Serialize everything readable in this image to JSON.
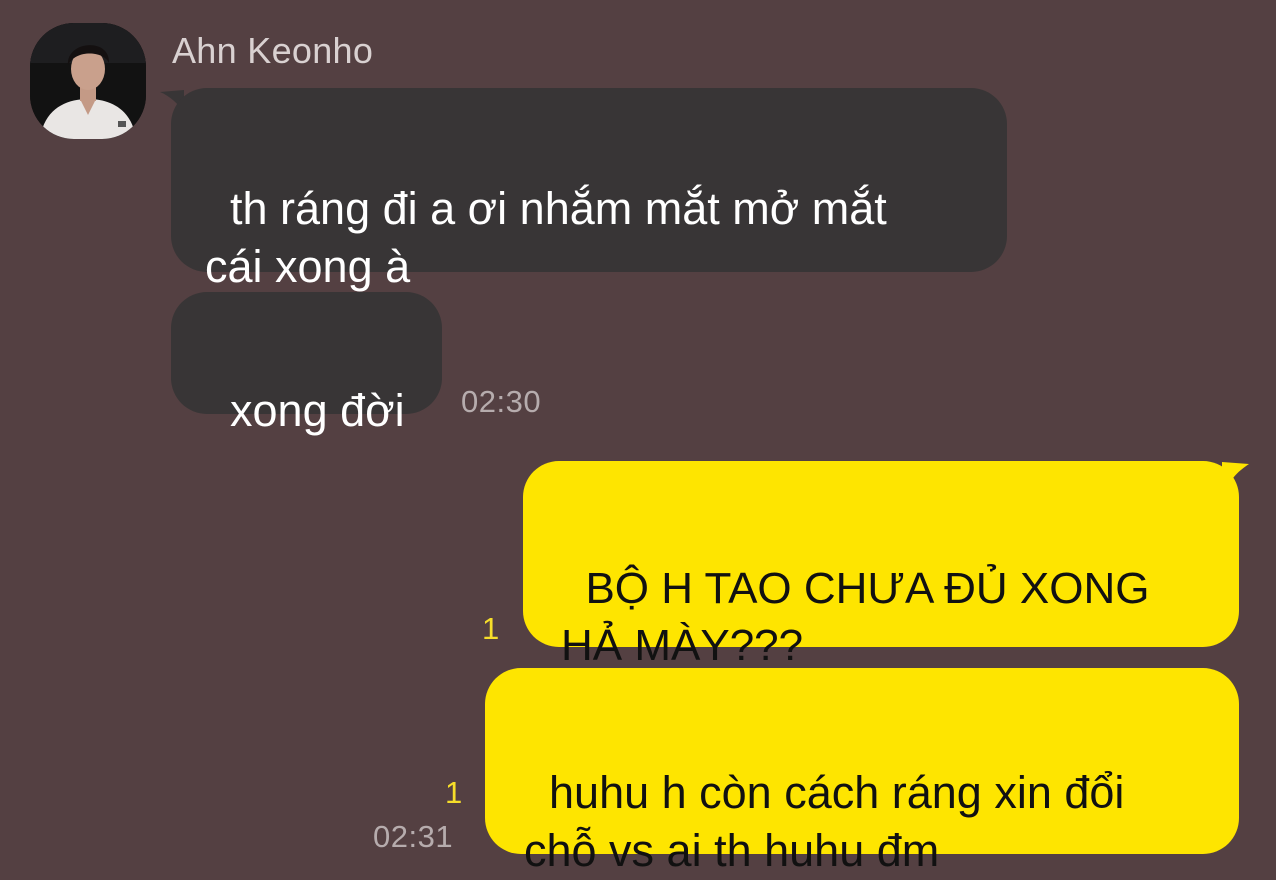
{
  "sender": {
    "name": "Ahn Keonho"
  },
  "messages": {
    "incoming": [
      {
        "text": "th ráng đi a ơi nhắm mắt mở mắt\ncái xong à"
      },
      {
        "text": "xong đời",
        "time": "02:30"
      }
    ],
    "outgoing": [
      {
        "text": "BỘ H TAO CHƯA ĐỦ XONG\nHẢ MÀY???",
        "unread": "1"
      },
      {
        "text": "huhu h còn cách ráng xin đổi\nchỗ vs ai th huhu đm",
        "unread": "1",
        "time": "02:31"
      }
    ]
  },
  "colors": {
    "background": "#544042",
    "incoming_bubble": "#383536",
    "outgoing_bubble": "#fee500",
    "unread_count": "#f6de2a"
  }
}
